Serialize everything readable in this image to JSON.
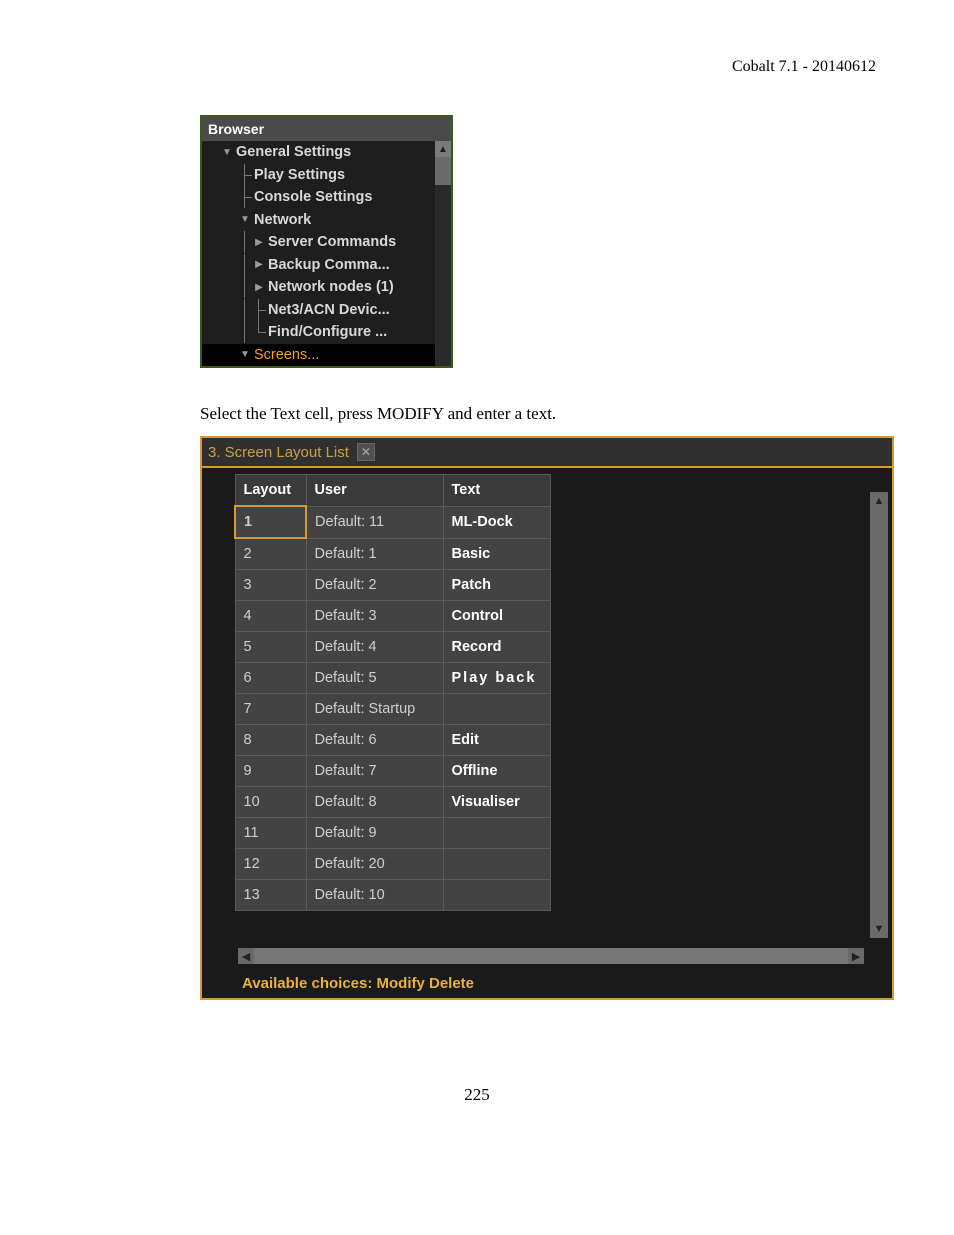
{
  "doc": {
    "header": "Cobalt 7.1 - 20140612",
    "instruction": "Select the Text cell, press MODIFY and enter a text.",
    "page_number": "225"
  },
  "browser": {
    "title": "Browser",
    "tree": {
      "general": "General Settings",
      "play": "Play Settings",
      "console": "Console Settings",
      "network": "Network",
      "server_cmds": "Server Commands",
      "backup": "Backup Comma...",
      "nodes": "Network nodes (1)",
      "net3": "Net3/ACN Devic...",
      "find": "Find/Configure ...",
      "screens": "Screens..."
    }
  },
  "layout": {
    "title": "3. Screen Layout List",
    "headers": {
      "layout": "Layout",
      "user": "User",
      "text": "Text"
    },
    "rows": [
      {
        "layout": "1",
        "user": "Default: 11",
        "text": "ML-Dock"
      },
      {
        "layout": "2",
        "user": "Default: 1",
        "text": "Basic"
      },
      {
        "layout": "3",
        "user": "Default: 2",
        "text": "Patch"
      },
      {
        "layout": "4",
        "user": "Default: 3",
        "text": "Control"
      },
      {
        "layout": "5",
        "user": "Default: 4",
        "text": "Record"
      },
      {
        "layout": "6",
        "user": "Default: 5",
        "text": "Play  back"
      },
      {
        "layout": "7",
        "user": "Default: Startup",
        "text": ""
      },
      {
        "layout": "8",
        "user": "Default: 6",
        "text": "Edit"
      },
      {
        "layout": "9",
        "user": "Default: 7",
        "text": "Offline"
      },
      {
        "layout": "10",
        "user": "Default: 8",
        "text": "Visualiser"
      },
      {
        "layout": "11",
        "user": "Default: 9",
        "text": ""
      },
      {
        "layout": "12",
        "user": "Default: 20",
        "text": ""
      },
      {
        "layout": "13",
        "user": "Default: 10",
        "text": ""
      }
    ],
    "status": "Available choices: Modify Delete"
  }
}
